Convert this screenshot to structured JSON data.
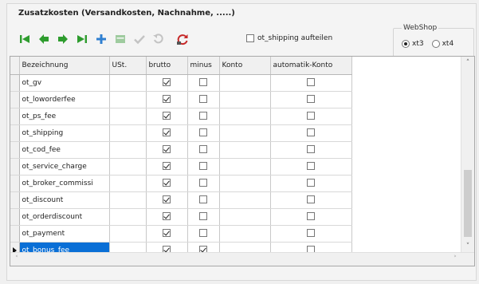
{
  "panel": {
    "title": "Zusatzkosten (Versandkosten, Nachnahme, .....)"
  },
  "toolbar": {
    "buttons": [
      {
        "icon": "first-record-icon",
        "enabled": true,
        "color": "#2e9c2e"
      },
      {
        "icon": "prev-record-icon",
        "enabled": true,
        "color": "#2e9c2e"
      },
      {
        "icon": "next-record-icon",
        "enabled": true,
        "color": "#2e9c2e"
      },
      {
        "icon": "last-record-icon",
        "enabled": true,
        "color": "#2e9c2e"
      },
      {
        "icon": "add-record-icon",
        "enabled": true,
        "color": "#2f7fd1"
      },
      {
        "icon": "delete-record-icon",
        "enabled": false,
        "color": "#3a9a3a"
      },
      {
        "icon": "confirm-icon",
        "enabled": false,
        "color": "#8a8a8a"
      },
      {
        "icon": "undo-icon",
        "enabled": false,
        "color": "#8a8a8a"
      },
      {
        "icon": "refresh-icon",
        "enabled": true,
        "color": "#c62828"
      }
    ]
  },
  "shipping_split": {
    "label": "ot_shipping aufteilen",
    "checked": false
  },
  "webshop": {
    "legend": "WebShop",
    "options": [
      {
        "label": "xt3",
        "selected": true
      },
      {
        "label": "xt4",
        "selected": false
      }
    ]
  },
  "grid": {
    "columns": [
      "Bezeichnung",
      "USt.",
      "brutto",
      "minus",
      "Konto",
      "automatik-Konto"
    ],
    "rows": [
      {
        "name": "ot_gv",
        "ust": "",
        "brutto": true,
        "minus": false,
        "konto": "",
        "auto": false
      },
      {
        "name": "ot_loworderfee",
        "ust": "",
        "brutto": true,
        "minus": false,
        "konto": "",
        "auto": false
      },
      {
        "name": "ot_ps_fee",
        "ust": "",
        "brutto": true,
        "minus": false,
        "konto": "",
        "auto": false
      },
      {
        "name": "ot_shipping",
        "ust": "",
        "brutto": true,
        "minus": false,
        "konto": "",
        "auto": false
      },
      {
        "name": "ot_cod_fee",
        "ust": "",
        "brutto": true,
        "minus": false,
        "konto": "",
        "auto": false
      },
      {
        "name": "ot_service_charge",
        "ust": "",
        "brutto": true,
        "minus": false,
        "konto": "",
        "auto": false
      },
      {
        "name": "ot_broker_commissi",
        "ust": "",
        "brutto": true,
        "minus": false,
        "konto": "",
        "auto": false
      },
      {
        "name": "ot_discount",
        "ust": "",
        "brutto": true,
        "minus": false,
        "konto": "",
        "auto": false
      },
      {
        "name": "ot_orderdiscount",
        "ust": "",
        "brutto": true,
        "minus": false,
        "konto": "",
        "auto": false
      },
      {
        "name": "ot_payment",
        "ust": "",
        "brutto": true,
        "minus": false,
        "konto": "",
        "auto": false
      },
      {
        "name": "ot_bonus_fee",
        "ust": "",
        "brutto": true,
        "minus": true,
        "konto": "",
        "auto": false,
        "selected": true
      }
    ],
    "selection_color": "#0a6fd6"
  }
}
